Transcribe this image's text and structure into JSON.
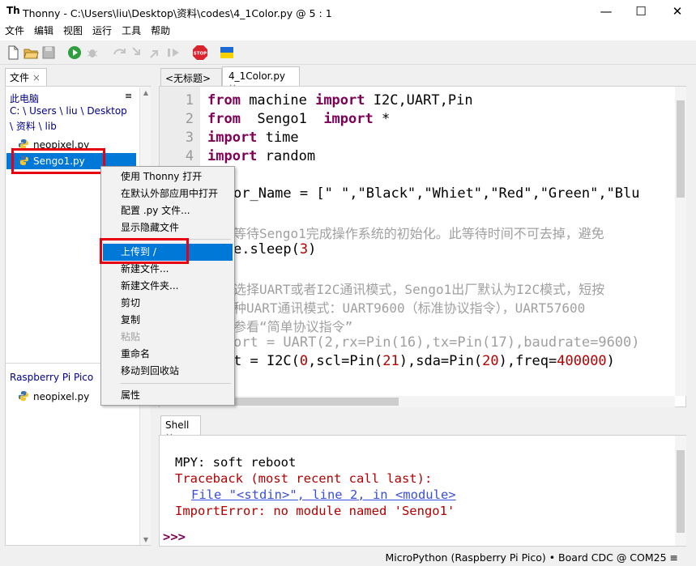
{
  "window": {
    "title": "Thonny  -  C:\\Users\\liu\\Desktop\\资料\\codes\\4_1Color.py  @  5 : 1",
    "logo_text": "Th",
    "minimize": "—",
    "maximize": "☐",
    "close": "✕"
  },
  "menubar": [
    "文件",
    "编辑",
    "视图",
    "运行",
    "工具",
    "帮助"
  ],
  "toolbar": {
    "icons": [
      "new-file-icon",
      "open-folder-icon",
      "save-icon",
      "run-icon",
      "debug-icon",
      "step-over-icon",
      "step-into-icon",
      "step-out-icon",
      "resume-icon",
      "stop-icon",
      "ukraine-flag-icon"
    ],
    "stop_label": "STOP"
  },
  "files_pane": {
    "tab_label": "文件",
    "close": "×",
    "menu_glyph": "≡",
    "computer_header": "此电脑",
    "path_line1": "C: \\ Users \\ liu \\ Desktop",
    "path_line2": "\\ 资料 \\ lib",
    "local_files": [
      "neopixel.py",
      "Sengo1.py"
    ],
    "device_header": "Raspberry Pi Pico",
    "device_files": [
      "neopixel.py"
    ]
  },
  "context_menu": {
    "items": [
      {
        "label": "使用 Thonny 打开",
        "enabled": true
      },
      {
        "label": "在默认外部应用中打开",
        "enabled": true
      },
      {
        "label": "配置 .py 文件...",
        "enabled": true
      },
      {
        "label": "显示隐藏文件",
        "enabled": true
      },
      {
        "label": "上传到 /",
        "enabled": true,
        "highlighted": true
      },
      {
        "label": "新建文件...",
        "enabled": true
      },
      {
        "label": "新建文件夹...",
        "enabled": true
      },
      {
        "label": "剪切",
        "enabled": true
      },
      {
        "label": "复制",
        "enabled": true
      },
      {
        "label": "粘贴",
        "enabled": false
      },
      {
        "label": "重命名",
        "enabled": true
      },
      {
        "label": "移动到回收站",
        "enabled": true
      },
      {
        "label": "属性",
        "enabled": true
      }
    ]
  },
  "editor": {
    "tabs": [
      {
        "label": "<无标题>",
        "close": "×"
      },
      {
        "label": "4_1Color.py",
        "close": "×"
      }
    ],
    "line_numbers": [
      "1",
      "2",
      "3",
      "4"
    ],
    "code": {
      "l1_kw1": "from",
      "l1_mid": " machine ",
      "l1_kw2": "import",
      "l1_rest": " I2C,UART,Pin",
      "l2_kw1": "from",
      "l2_mid": "  Sengo1  ",
      "l2_kw2": "import",
      "l2_rest": " *",
      "l3_kw": "import",
      "l3_rest": " time",
      "l4_kw": "import",
      "l4_rest": " random",
      "l6": "or_Name = [\" \",\"Black\",\"Whiet\",\"Red\",\"Green\",\"Blu",
      "l8_cm": "等待Sengo1完成操作系统的初始化。此等待时间不可去掉，避免",
      "l9_a": "e.sleep(",
      "l9_num": "3",
      "l9_b": ")",
      "l11_cm": "选择UART或者I2C通讯模式，Sengo1出厂默认为I2C模式，短按",
      "l12_cm": "种UART通讯模式：UART9600（标准协议指令），UART57600",
      "l13_cm": "参看“简单协议指令”",
      "l14_cm": "ort = UART(2,rx=Pin(16),tx=Pin(17),baudrate=9600)",
      "l15_a": "t = I2C(",
      "l15_n1": "0",
      "l15_b": ",scl=Pin(",
      "l15_n2": "21",
      "l15_c": "),sda=Pin(",
      "l15_n3": "20",
      "l15_d": "),freq=",
      "l15_n4": "400000",
      "l15_e": ")"
    }
  },
  "shell": {
    "tab_label": "Shell",
    "close": "×",
    "line1": "MPY: soft reboot",
    "line2": "Traceback (most recent call last):",
    "line3": "File \"<stdin>\", line 2, in <module>",
    "line4": "ImportError: no module named 'Sengo1'",
    "prompt": ">>>"
  },
  "statusbar": {
    "text": "MicroPython (Raspberry Pi Pico) • Board CDC @ COM25  ≡"
  },
  "colors": {
    "selection": "#0078d7",
    "annotation_red": "#e60012",
    "keyword": "#7f0055",
    "error": "#b40000",
    "link": "#3a4ed8"
  }
}
